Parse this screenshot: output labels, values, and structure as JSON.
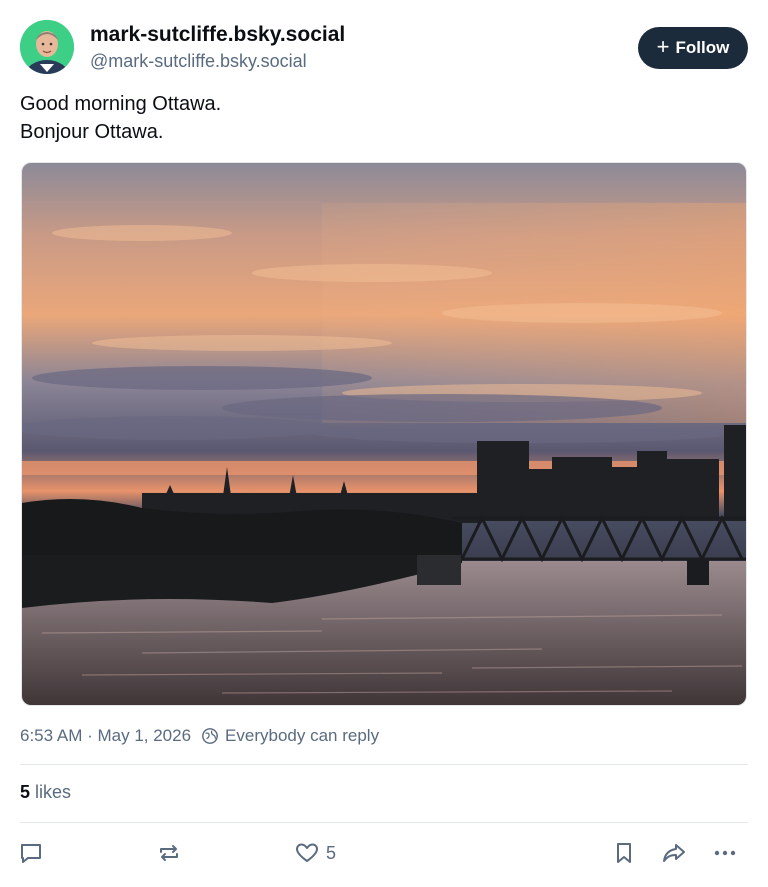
{
  "post": {
    "author": {
      "display_name": "mark-sutcliffe.bsky.social",
      "handle": "@mark-sutcliffe.bsky.social",
      "avatar_icon": "avatar-photo"
    },
    "follow_label": "Follow",
    "text_lines": [
      "Good morning Ottawa.",
      "Bonjour Ottawa."
    ],
    "image_description_icon": "sunset-ottawa-photo",
    "timestamp": "6:53 AM · May 1, 2026",
    "reply_setting": "Everybody can reply",
    "likes": {
      "count": "5",
      "label": "likes"
    },
    "actions": {
      "reply_icon": "comment-icon",
      "repost_icon": "repost-icon",
      "like_icon": "heart-icon",
      "like_count": "5",
      "bookmark_icon": "bookmark-icon",
      "share_icon": "share-icon",
      "more_icon": "more-icon"
    }
  },
  "colors": {
    "follow_button_bg": "#1c2b3b",
    "avatar_bg": "#3ecf86",
    "muted_text": "#5a6b80"
  }
}
